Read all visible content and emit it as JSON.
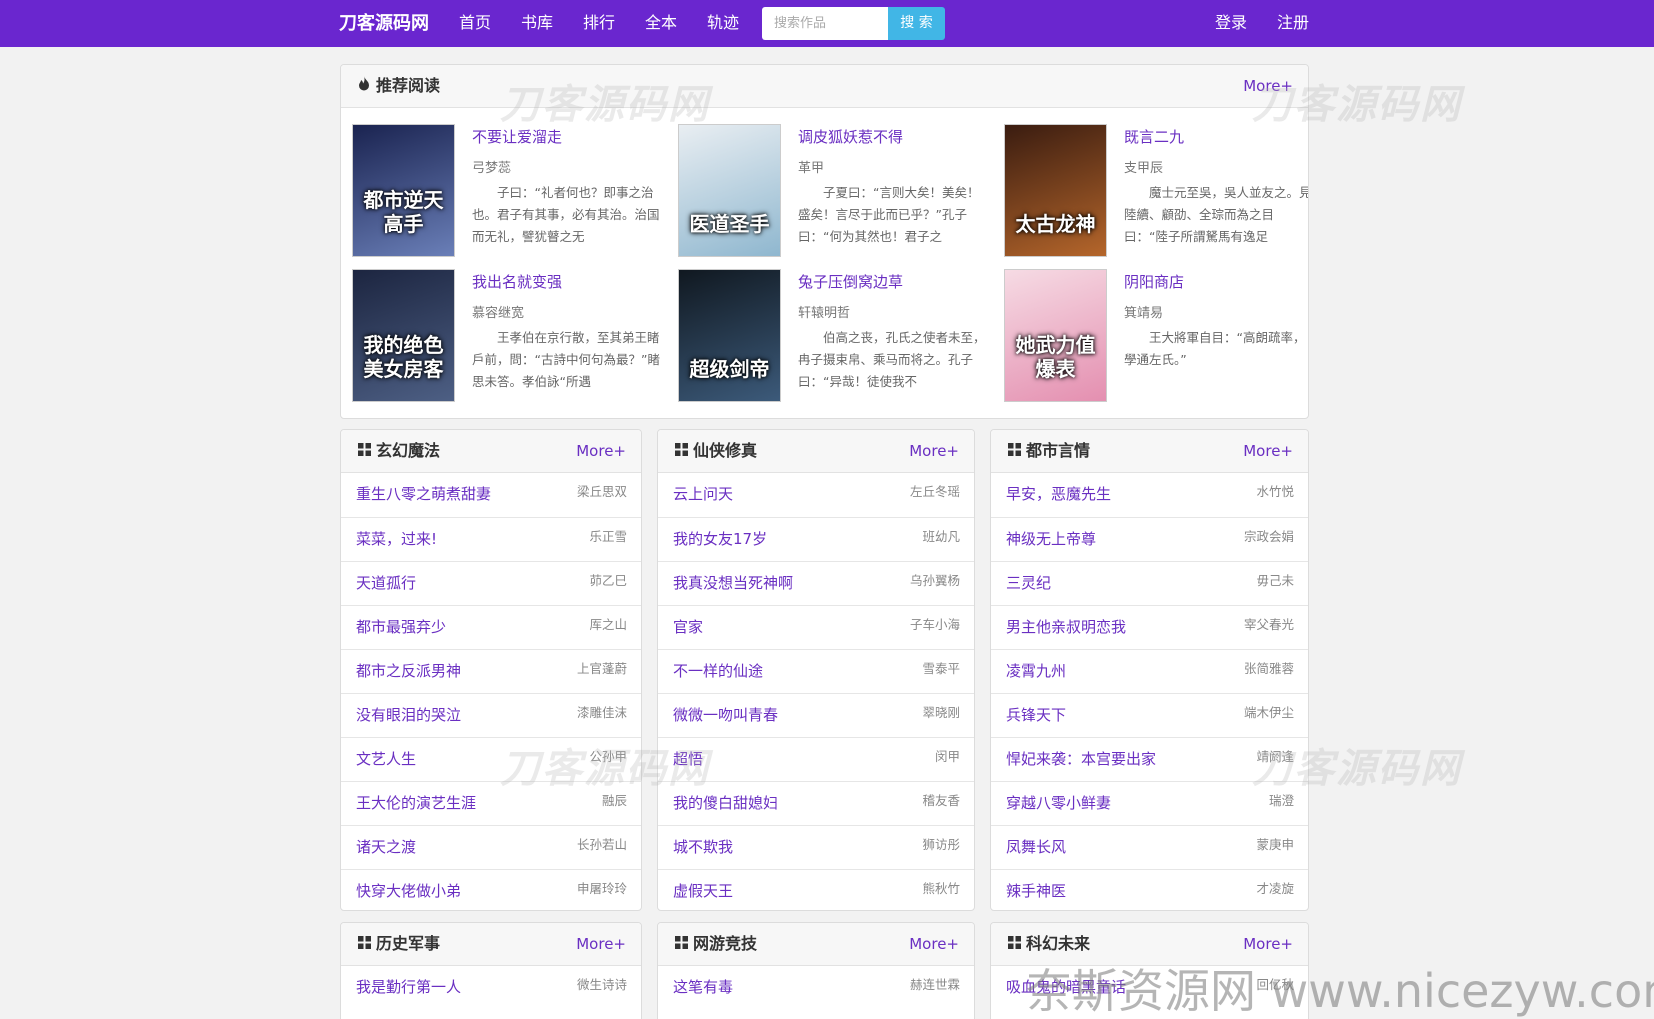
{
  "nav": {
    "brand": "刀客源码网",
    "items": [
      {
        "label": "首页"
      },
      {
        "label": "书库"
      },
      {
        "label": "排行"
      },
      {
        "label": "全本"
      },
      {
        "label": "轨迹"
      }
    ],
    "search": {
      "placeholder": "搜索作品",
      "button": "搜 索"
    },
    "login": "登录",
    "register": "注册"
  },
  "recommend": {
    "icon": "fire-icon",
    "title": "推荐阅读",
    "more": "More+",
    "books": [
      {
        "title": "不要让爱溜走",
        "author": "弓梦蕊",
        "desc": "子曰：“礼者何也？即事之治也。君子有其事，必有其治。治国而无礼，譬犹瞽之无",
        "cover_text": "都市逆天高手",
        "cover_colors": [
          "#1a2350",
          "#6a7fb8"
        ]
      },
      {
        "title": "调皮狐妖惹不得",
        "author": "革甲",
        "desc": "子夏曰：“言则大矣！美矣！盛矣！言尽于此而已乎？”孔子曰：“何为其然也！君子之",
        "cover_text": "医道圣手",
        "cover_colors": [
          "#e9eef2",
          "#8fb7cf"
        ]
      },
      {
        "title": "既言二九",
        "author": "支甲辰",
        "desc": "魔士元至吳，吳人並友之。見陸續、顧劭、全琮而為之目曰：“陸子所謂駑馬有逸足",
        "cover_text": "太古龙神",
        "cover_colors": [
          "#3a1c10",
          "#b5662b"
        ]
      },
      {
        "title": "我出名就变强",
        "author": "慕容继宽",
        "desc": "王孝伯在京行散，至其弟王睹戶前，問：“古詩中何句為最？”睹思未答。孝伯詠“所遇",
        "cover_text": "我的绝色美女房客",
        "cover_colors": [
          "#1c2540",
          "#4d5f84"
        ]
      },
      {
        "title": "兔子压倒窝边草",
        "author": "轩辕明哲",
        "desc": "伯高之丧，孔氏之使者未至，冉子摄束帛、乘马而将之。孔子曰：“异哉！徒使我不",
        "cover_text": "超级剑帝",
        "cover_colors": [
          "#101820",
          "#3c5a7a"
        ]
      },
      {
        "title": "阴阳商店",
        "author": "箕靖易",
        "desc": "王大將軍自目：“高朗疏率，學通左氏。”",
        "cover_text": "她武力值爆表",
        "cover_colors": [
          "#f6dbe4",
          "#e48fb0"
        ]
      }
    ]
  },
  "categories": [
    {
      "icon": "grid-icon",
      "title": "玄幻魔法",
      "more": "More+",
      "items": [
        {
          "title": "重生八零之萌煮甜妻",
          "author": "梁丘思双"
        },
        {
          "title": "菜菜，过来!",
          "author": "乐正雪"
        },
        {
          "title": "天道孤行",
          "author": "茆乙巳"
        },
        {
          "title": "都市最强弃少",
          "author": "厍之山"
        },
        {
          "title": "都市之反派男神",
          "author": "上官蓬蔚"
        },
        {
          "title": "没有眼泪的哭泣",
          "author": "漆雕佳沫"
        },
        {
          "title": "文艺人生",
          "author": "公孙甲"
        },
        {
          "title": "王大伦的演艺生涯",
          "author": "融辰"
        },
        {
          "title": "诸天之渡",
          "author": "长孙若山"
        },
        {
          "title": "快穿大佬做小弟",
          "author": "申屠玲玲"
        }
      ]
    },
    {
      "icon": "grid-icon",
      "title": "仙侠修真",
      "more": "More+",
      "items": [
        {
          "title": "云上问天",
          "author": "左丘冬瑶"
        },
        {
          "title": "我的女友17岁",
          "author": "班幼凡"
        },
        {
          "title": "我真没想当死神啊",
          "author": "乌孙翼杨"
        },
        {
          "title": "官家",
          "author": "子车小海"
        },
        {
          "title": "不一样的仙途",
          "author": "雪泰平"
        },
        {
          "title": "微微一吻叫青春",
          "author": "翠晓刚"
        },
        {
          "title": "超悟",
          "author": "闵甲"
        },
        {
          "title": "我的傻白甜媳妇",
          "author": "稽友香"
        },
        {
          "title": "城不欺我",
          "author": "狮访彤"
        },
        {
          "title": "虚假天王",
          "author": "熊秋竹"
        }
      ]
    },
    {
      "icon": "grid-icon",
      "title": "都市言情",
      "more": "More+",
      "items": [
        {
          "title": "早安，恶魔先生",
          "author": "水竹悦"
        },
        {
          "title": "神级无上帝尊",
          "author": "宗政会娟"
        },
        {
          "title": "三灵纪",
          "author": "毋己未"
        },
        {
          "title": "男主他亲叔明恋我",
          "author": "宰父春光"
        },
        {
          "title": "凌霄九州",
          "author": "张简雅蓉"
        },
        {
          "title": "兵锋天下",
          "author": "端木伊尘"
        },
        {
          "title": "悍妃来袭：本宫要出家",
          "author": "靖阏逢"
        },
        {
          "title": "穿越八零小鲜妻",
          "author": "瑞澄"
        },
        {
          "title": "凤舞长风",
          "author": "蒙庚申"
        },
        {
          "title": "辣手神医",
          "author": "才凌旋"
        }
      ]
    },
    {
      "icon": "grid-icon",
      "title": "历史军事",
      "more": "More+",
      "items": [
        {
          "title": "我是勤行第一人",
          "author": "微生诗诗"
        }
      ]
    },
    {
      "icon": "grid-icon",
      "title": "网游竞技",
      "more": "More+",
      "items": [
        {
          "title": "这笔有毒",
          "author": "赫连世霖"
        }
      ]
    },
    {
      "icon": "grid-icon",
      "title": "科幻未来",
      "more": "More+",
      "items": [
        {
          "title": "吸血鬼的暗黑童话",
          "author": "回亿秋"
        }
      ]
    }
  ],
  "watermarks": {
    "site": "刀客源码网",
    "footer": "奈斯资源网 www.nicezyw.com"
  },
  "colors": {
    "navbar": "#6a26cf",
    "link": "#6a2fc2",
    "search_button": "#41b6e6",
    "background": "#f2f2f2"
  }
}
